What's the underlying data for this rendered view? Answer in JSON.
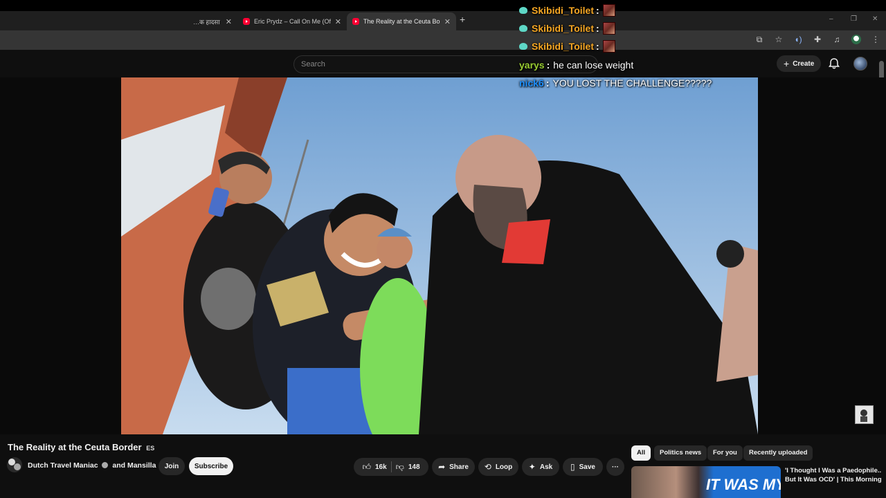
{
  "browser": {
    "tabs": [
      {
        "title": "…क हादसा का…",
        "active": false
      },
      {
        "title": "Eric Prydz – Call On Me (Official",
        "active": false
      },
      {
        "title": "The Reality at the Ceuta Border",
        "active": true
      }
    ],
    "new_tab_symbol": "+",
    "window_controls": [
      "–",
      "❐",
      "✕"
    ]
  },
  "youtube": {
    "search_placeholder": "Search",
    "create_label": "Create",
    "video_title": "The Reality at the Ceuta Border",
    "title_language": "ES",
    "channel_text": "Dutch Travel Maniac",
    "channel_collab": "and Mansilla",
    "join_label": "Join",
    "subscribe_label": "Subscribe",
    "like_count": "16k",
    "dislike_count": "148",
    "share_label": "Share",
    "loop_label": "Loop",
    "ask_label": "Ask",
    "save_label": "Save",
    "more_symbol": "···"
  },
  "related": {
    "chips": [
      "All",
      "Politics news",
      "For you",
      "Recently uploaded"
    ],
    "active_chip": "All",
    "first_video_title": "'I Thought I Was a Paedophile.. But It Was OCD' | This Morning",
    "first_video_thumb_text": "IT WAS MY"
  },
  "chat_overlay": {
    "messages": [
      {
        "user": "Skibidi_Toilet",
        "text": "",
        "user_color": "#f5a623",
        "has_badge": true,
        "has_emote": true
      },
      {
        "user": "Skibidi_Toilet",
        "text": "",
        "user_color": "#f5a623",
        "has_badge": true,
        "has_emote": true
      },
      {
        "user": "Skibidi_Toilet",
        "text": "",
        "user_color": "#f5a623",
        "has_badge": true,
        "has_emote": true
      },
      {
        "user": "yarys",
        "text": "he can lose weight",
        "user_color": "#9acd32",
        "has_badge": false,
        "has_emote": false
      },
      {
        "user": "nick6",
        "text": "YOU LOST THE CHALLENGE?????",
        "user_color": "#1e90ff",
        "has_badge": false,
        "has_emote": false
      }
    ]
  },
  "colors": {
    "yt_background": "#0f0f0f",
    "pill_background": "#272727",
    "subscribe_background": "#f1f1f1",
    "youtube_red": "#ff0033"
  },
  "icons": [
    "youtube-favicon",
    "close-icon",
    "plus-icon",
    "bell-icon",
    "like-icon",
    "dislike-icon",
    "share-icon",
    "loop-icon",
    "sparkle-icon",
    "bookmark-icon",
    "more-icon",
    "verified-icon",
    "extensions-icon",
    "star-icon"
  ]
}
